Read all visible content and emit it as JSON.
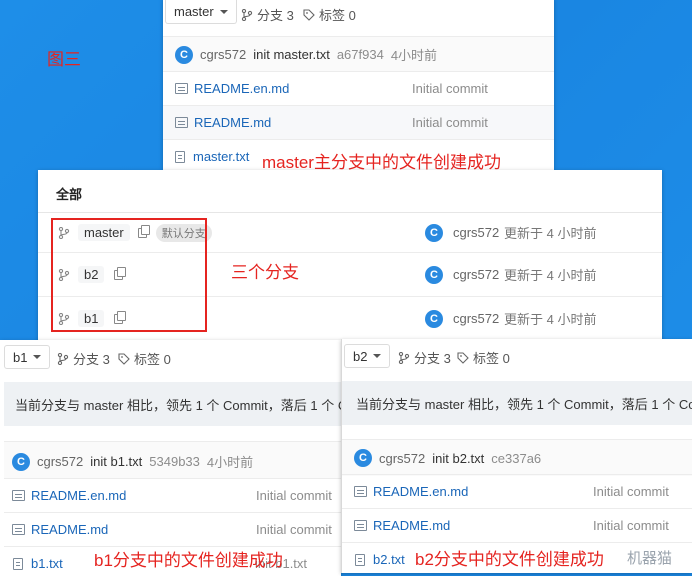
{
  "annotations": {
    "fig_label": "图三",
    "master_success": "master主分支中的文件创建成功",
    "three_branches": "三个分支",
    "b1_success": "b1分支中的文件创建成功",
    "b2_success": "b2分支中的文件创建成功",
    "watermark": "机器猫"
  },
  "colors": {
    "background": "#1e8ee8",
    "annotation_red": "#e52420",
    "link_blue": "#1a66b8",
    "avatar_blue": "#2a8ae0"
  },
  "master_panel": {
    "branch_select": "master",
    "branches": "分支 3",
    "tags": "标签 0",
    "commit": {
      "avatar": "C",
      "author": "cgrs572",
      "message": "init master.txt",
      "hash": "a67f934",
      "time": "4小时前"
    },
    "files": [
      {
        "icon": "file-icon",
        "name": "README.en.md",
        "commit": "Initial commit"
      },
      {
        "icon": "file-icon",
        "name": "README.md",
        "commit": "Initial commit"
      },
      {
        "icon": "doc-icon",
        "name": "master.txt",
        "commit": ""
      }
    ]
  },
  "branches_panel": {
    "header": "全部",
    "rows": [
      {
        "name": "master",
        "tag": "默认分支",
        "avatar": "C",
        "author": "cgrs572",
        "updated": "更新于 4 小时前"
      },
      {
        "name": "b2",
        "tag": "",
        "avatar": "C",
        "author": "cgrs572",
        "updated": "更新于 4 小时前"
      },
      {
        "name": "b1",
        "tag": "",
        "avatar": "C",
        "author": "cgrs572",
        "updated": "更新于 4 小时前"
      }
    ]
  },
  "b1_panel": {
    "branch_select": "b1",
    "branches": "分支 3",
    "tags": "标签 0",
    "compare": "当前分支与 master 相比，领先 1 个 Commit，落后 1 个 Co",
    "commit": {
      "avatar": "C",
      "author": "cgrs572",
      "message": "init b1.txt",
      "hash": "5349b33",
      "time": "4小时前"
    },
    "files": [
      {
        "icon": "file-icon",
        "name": "README.en.md",
        "commit": "Initial commit"
      },
      {
        "icon": "file-icon",
        "name": "README.md",
        "commit": "Initial commit"
      },
      {
        "icon": "doc-icon",
        "name": "b1.txt",
        "commit": "init b1.txt"
      }
    ]
  },
  "b2_panel": {
    "branch_select": "b2",
    "branches": "分支 3",
    "tags": "标签 0",
    "compare": "当前分支与 master 相比，领先 1 个 Commit，落后 1 个 Comm",
    "commit": {
      "avatar": "C",
      "author": "cgrs572",
      "message": "init b2.txt",
      "hash": "ce337a6",
      "time": "4小时前"
    },
    "files": [
      {
        "icon": "file-icon",
        "name": "README.en.md",
        "commit": "Initial commit"
      },
      {
        "icon": "file-icon",
        "name": "README.md",
        "commit": "Initial commit"
      },
      {
        "icon": "doc-icon",
        "name": "b2.txt",
        "commit": ""
      }
    ]
  }
}
